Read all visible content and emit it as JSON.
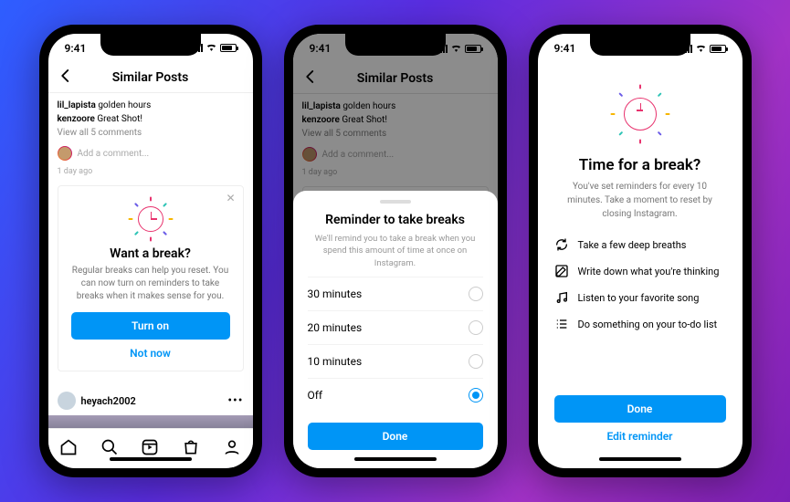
{
  "status": {
    "time": "9:41"
  },
  "header": {
    "title": "Similar Posts"
  },
  "post": {
    "caption_user": "lil_lapista",
    "caption_text": "golden hours",
    "comment_user": "kenzoore",
    "comment_text": "Great Shot!",
    "view_all": "View all 5 comments",
    "add_comment_placeholder": "Add a comment...",
    "time_ago": "1 day ago"
  },
  "prompt_card": {
    "title": "Want a break?",
    "body": "Regular breaks can help you reset. You can now turn on reminders to take breaks when it makes sense for you.",
    "primary": "Turn on",
    "secondary": "Not now"
  },
  "next_post": {
    "user": "heyach2002"
  },
  "sheet": {
    "title": "Reminder to take breaks",
    "sub": "We'll remind you to take a break when you spend this amount of time at once on Instagram.",
    "options": [
      "30 minutes",
      "20 minutes",
      "10 minutes",
      "Off"
    ],
    "selected_index": 3,
    "done": "Done"
  },
  "break_screen": {
    "title": "Time for a break?",
    "sub": "You've set reminders for every 10 minutes. Take a moment to reset by closing Instagram.",
    "tips": [
      "Take a few deep breaths",
      "Write down what you're thinking",
      "Listen to your favorite song",
      "Do something on your to-do list"
    ],
    "done": "Done",
    "edit": "Edit reminder"
  }
}
